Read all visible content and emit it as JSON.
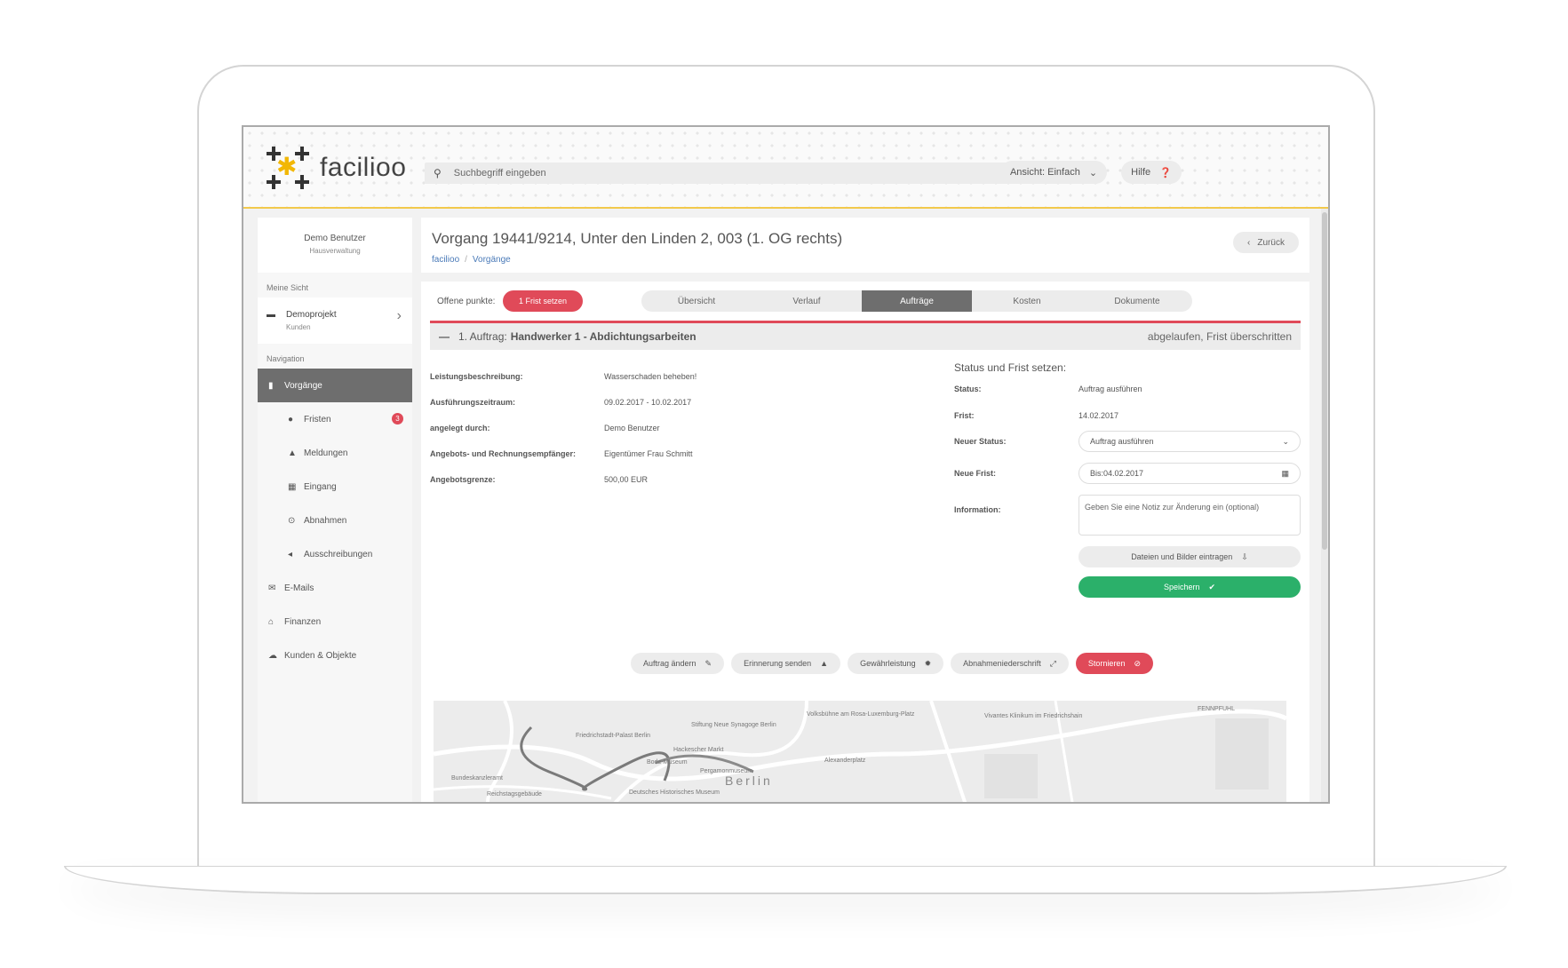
{
  "app": {
    "logo_text": "facilioo",
    "search_placeholder": "Suchbegriff eingeben",
    "view_label": "Ansicht: Einfach",
    "help_label": "Hilfe"
  },
  "sidebar": {
    "user_name": "Demo Benutzer",
    "user_role": "Hausverwaltung",
    "section_mine": "Meine Sicht",
    "project_name": "Demoprojekt",
    "project_sub": "Kunden",
    "section_nav": "Navigation",
    "items": [
      {
        "label": "Vorgänge"
      },
      {
        "label": "Fristen",
        "badge": "3"
      },
      {
        "label": "Meldungen"
      },
      {
        "label": "Eingang"
      },
      {
        "label": "Abnahmen"
      },
      {
        "label": "Ausschreibungen"
      },
      {
        "label": "E-Mails"
      },
      {
        "label": "Finanzen"
      },
      {
        "label": "Kunden & Objekte"
      }
    ]
  },
  "header": {
    "title": "Vorgang 19441/9214, Unter den Linden 2, 003 (1. OG rechts)",
    "crumb_1": "facilioo",
    "crumb_sep": "/",
    "crumb_2": "Vorgänge",
    "back_label": "Zurück"
  },
  "tabs": {
    "offene_label": "Offene punkte:",
    "frist_button": "1 Frist setzen",
    "items": [
      "Übersicht",
      "Verlauf",
      "Aufträge",
      "Kosten",
      "Dokumente"
    ],
    "active_index": 2
  },
  "auftrag": {
    "prefix": "1. Auftrag: ",
    "name": "Handwerker 1 - Abdichtungsarbeiten",
    "status": "abgelaufen, Frist überschritten"
  },
  "details": [
    {
      "key": "Leistungsbeschreibung:",
      "value": "Wasserschaden beheben!"
    },
    {
      "key": "Ausführungszeitraum:",
      "value": "09.02.2017 - 10.02.2017"
    },
    {
      "key": "angelegt durch:",
      "value": "Demo Benutzer"
    },
    {
      "key": "Angebots- und Rechnungsempfänger:",
      "value": "Eigentümer Frau Schmitt"
    },
    {
      "key": "Angebotsgrenze:",
      "value": "500,00 EUR"
    }
  ],
  "status_form": {
    "heading": "Status und Frist setzen:",
    "status_label": "Status:",
    "status_value": "Auftrag ausführen",
    "frist_label": "Frist:",
    "frist_value": "14.02.2017",
    "new_status_label": "Neuer Status:",
    "new_status_value": "Auftrag ausführen",
    "new_frist_label": "Neue Frist:",
    "new_frist_value": "Bis:04.02.2017",
    "info_label": "Information:",
    "info_placeholder": "Geben Sie eine Notiz zur Änderung ein (optional)",
    "upload_label": "Dateien und Bilder eintragen",
    "save_label": "Speichern"
  },
  "actions": {
    "change": "Auftrag ändern",
    "reminder": "Erinnerung senden",
    "warranty": "Gewährleistung",
    "acceptance": "Abnahmeniederschrift",
    "cancel": "Stornieren"
  },
  "map": {
    "city": "Berlin",
    "labels": [
      "Friedrichstadt-Palast Berlin",
      "Stiftung Neue Synagoge Berlin",
      "Volksbühne am Rosa-Luxemburg-Platz",
      "Hackescher Markt",
      "Alexanderplatz",
      "Bode-Museum",
      "Pergamonmuseum",
      "Bundeskanzleramt",
      "Reichstagsgebäude",
      "Deutsches Historisches Museum",
      "Vivantes Klinikum im Friedrichshain",
      "FENNPFUHL"
    ]
  },
  "icons": {
    "search": "search-icon",
    "chevron_down": "chevron-down-icon",
    "help": "question-circle-icon",
    "chevron_left": "chevron-left-icon",
    "chevron_right": "chevron-right-icon",
    "calendar": "calendar-icon",
    "upload": "upload-icon",
    "check": "check-icon",
    "pencil": "pencil-icon",
    "bell": "bell-icon",
    "gear": "gear-icon",
    "expand": "expand-icon",
    "ban": "ban-icon"
  },
  "colors": {
    "accent_red": "#e04a59",
    "success_green": "#2bb06a",
    "header_accent": "#f2c94c",
    "active_dark": "#6e6e6e"
  }
}
